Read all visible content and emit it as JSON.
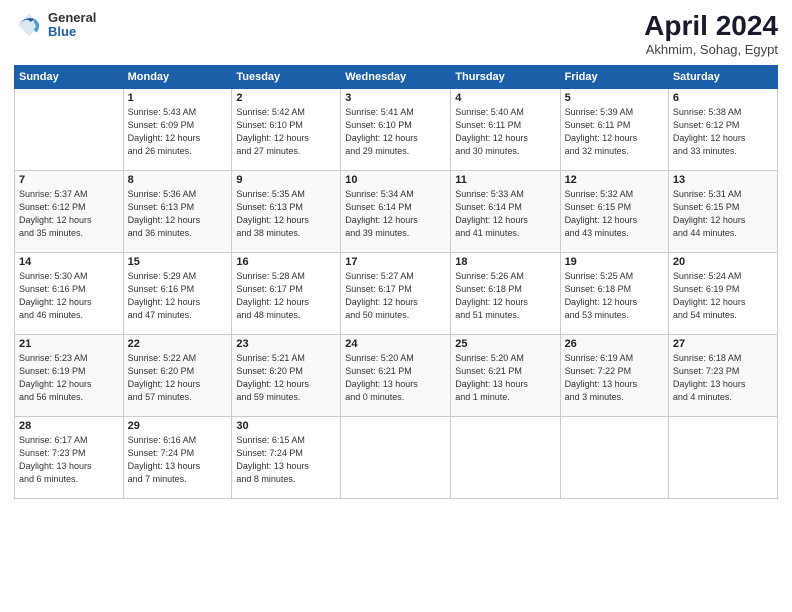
{
  "header": {
    "logo_general": "General",
    "logo_blue": "Blue",
    "title": "April 2024",
    "subtitle": "Akhmim, Sohag, Egypt"
  },
  "weekdays": [
    "Sunday",
    "Monday",
    "Tuesday",
    "Wednesday",
    "Thursday",
    "Friday",
    "Saturday"
  ],
  "weeks": [
    [
      {
        "day": "",
        "info": ""
      },
      {
        "day": "1",
        "info": "Sunrise: 5:43 AM\nSunset: 6:09 PM\nDaylight: 12 hours\nand 26 minutes."
      },
      {
        "day": "2",
        "info": "Sunrise: 5:42 AM\nSunset: 6:10 PM\nDaylight: 12 hours\nand 27 minutes."
      },
      {
        "day": "3",
        "info": "Sunrise: 5:41 AM\nSunset: 6:10 PM\nDaylight: 12 hours\nand 29 minutes."
      },
      {
        "day": "4",
        "info": "Sunrise: 5:40 AM\nSunset: 6:11 PM\nDaylight: 12 hours\nand 30 minutes."
      },
      {
        "day": "5",
        "info": "Sunrise: 5:39 AM\nSunset: 6:11 PM\nDaylight: 12 hours\nand 32 minutes."
      },
      {
        "day": "6",
        "info": "Sunrise: 5:38 AM\nSunset: 6:12 PM\nDaylight: 12 hours\nand 33 minutes."
      }
    ],
    [
      {
        "day": "7",
        "info": "Sunrise: 5:37 AM\nSunset: 6:12 PM\nDaylight: 12 hours\nand 35 minutes."
      },
      {
        "day": "8",
        "info": "Sunrise: 5:36 AM\nSunset: 6:13 PM\nDaylight: 12 hours\nand 36 minutes."
      },
      {
        "day": "9",
        "info": "Sunrise: 5:35 AM\nSunset: 6:13 PM\nDaylight: 12 hours\nand 38 minutes."
      },
      {
        "day": "10",
        "info": "Sunrise: 5:34 AM\nSunset: 6:14 PM\nDaylight: 12 hours\nand 39 minutes."
      },
      {
        "day": "11",
        "info": "Sunrise: 5:33 AM\nSunset: 6:14 PM\nDaylight: 12 hours\nand 41 minutes."
      },
      {
        "day": "12",
        "info": "Sunrise: 5:32 AM\nSunset: 6:15 PM\nDaylight: 12 hours\nand 43 minutes."
      },
      {
        "day": "13",
        "info": "Sunrise: 5:31 AM\nSunset: 6:15 PM\nDaylight: 12 hours\nand 44 minutes."
      }
    ],
    [
      {
        "day": "14",
        "info": "Sunrise: 5:30 AM\nSunset: 6:16 PM\nDaylight: 12 hours\nand 46 minutes."
      },
      {
        "day": "15",
        "info": "Sunrise: 5:29 AM\nSunset: 6:16 PM\nDaylight: 12 hours\nand 47 minutes."
      },
      {
        "day": "16",
        "info": "Sunrise: 5:28 AM\nSunset: 6:17 PM\nDaylight: 12 hours\nand 48 minutes."
      },
      {
        "day": "17",
        "info": "Sunrise: 5:27 AM\nSunset: 6:17 PM\nDaylight: 12 hours\nand 50 minutes."
      },
      {
        "day": "18",
        "info": "Sunrise: 5:26 AM\nSunset: 6:18 PM\nDaylight: 12 hours\nand 51 minutes."
      },
      {
        "day": "19",
        "info": "Sunrise: 5:25 AM\nSunset: 6:18 PM\nDaylight: 12 hours\nand 53 minutes."
      },
      {
        "day": "20",
        "info": "Sunrise: 5:24 AM\nSunset: 6:19 PM\nDaylight: 12 hours\nand 54 minutes."
      }
    ],
    [
      {
        "day": "21",
        "info": "Sunrise: 5:23 AM\nSunset: 6:19 PM\nDaylight: 12 hours\nand 56 minutes."
      },
      {
        "day": "22",
        "info": "Sunrise: 5:22 AM\nSunset: 6:20 PM\nDaylight: 12 hours\nand 57 minutes."
      },
      {
        "day": "23",
        "info": "Sunrise: 5:21 AM\nSunset: 6:20 PM\nDaylight: 12 hours\nand 59 minutes."
      },
      {
        "day": "24",
        "info": "Sunrise: 5:20 AM\nSunset: 6:21 PM\nDaylight: 13 hours\nand 0 minutes."
      },
      {
        "day": "25",
        "info": "Sunrise: 5:20 AM\nSunset: 6:21 PM\nDaylight: 13 hours\nand 1 minute."
      },
      {
        "day": "26",
        "info": "Sunrise: 6:19 AM\nSunset: 7:22 PM\nDaylight: 13 hours\nand 3 minutes."
      },
      {
        "day": "27",
        "info": "Sunrise: 6:18 AM\nSunset: 7:23 PM\nDaylight: 13 hours\nand 4 minutes."
      }
    ],
    [
      {
        "day": "28",
        "info": "Sunrise: 6:17 AM\nSunset: 7:23 PM\nDaylight: 13 hours\nand 6 minutes."
      },
      {
        "day": "29",
        "info": "Sunrise: 6:16 AM\nSunset: 7:24 PM\nDaylight: 13 hours\nand 7 minutes."
      },
      {
        "day": "30",
        "info": "Sunrise: 6:15 AM\nSunset: 7:24 PM\nDaylight: 13 hours\nand 8 minutes."
      },
      {
        "day": "",
        "info": ""
      },
      {
        "day": "",
        "info": ""
      },
      {
        "day": "",
        "info": ""
      },
      {
        "day": "",
        "info": ""
      }
    ]
  ]
}
